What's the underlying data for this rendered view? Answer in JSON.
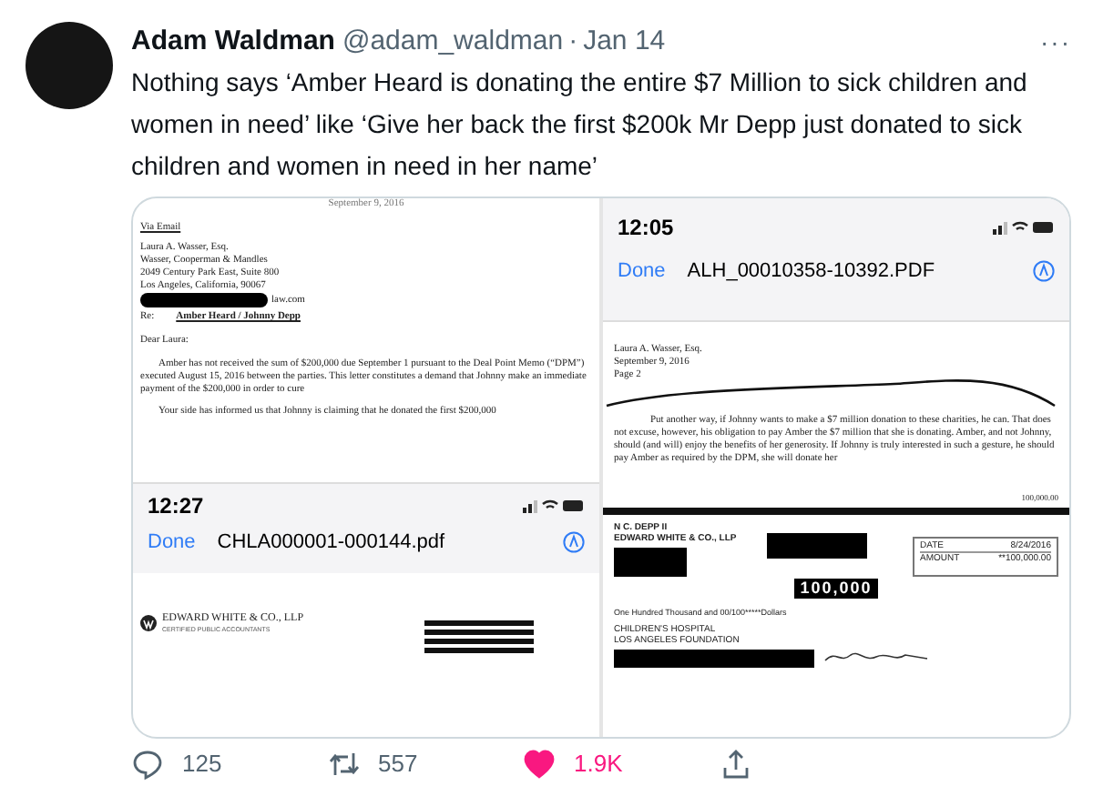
{
  "tweet": {
    "author": "Adam Waldman",
    "handle": "@adam_waldman",
    "separator": "·",
    "date": "Jan 14",
    "more": "···",
    "text": "Nothing says ‘Amber Heard is donating the entire $7 Million to sick children and women in need’ like ‘Give her back the first $200k Mr Depp just donated to sick children and women in need in her name’"
  },
  "media": {
    "left": {
      "letter": {
        "date_line": "September 9, 2016",
        "via": "Via Email",
        "address": [
          "Laura A. Wasser, Esq.",
          "Wasser, Cooperman & Mandles",
          "2049 Century Park East, Suite 800",
          "Los Angeles, California, 90067"
        ],
        "email_tail": "law.com",
        "re_label": "Re:",
        "re_text": "Amber Heard / Johnny Depp",
        "salutation": "Dear Laura:",
        "paragraph": "Amber has not received the sum of $200,000 due September 1 pursuant to the Deal Point Memo (“DPM”) executed August 15, 2016 between the parties. This letter constitutes a demand that Johnny make an immediate payment of the $200,000 in order to cure",
        "paragraph_2": "Your side has informed us that Johnny is claiming that he donated the first $200,000"
      },
      "phone": {
        "time": "12:27",
        "done": "Done",
        "file": "CHLA000001-000144.pdf"
      },
      "logo": {
        "name": "EDWARD WHITE & CO., LLP",
        "subtitle": "CERTIFIED PUBLIC ACCOUNTANTS"
      }
    },
    "right": {
      "phone": {
        "time": "12:05",
        "done": "Done",
        "file": "ALH_00010358-10392.PDF"
      },
      "letter": {
        "header": [
          "Laura A. Wasser, Esq.",
          "September 9, 2016",
          "Page 2"
        ],
        "paragraph": "Put another way, if Johnny wants to make a $7 million donation to these charities, he can. That does not excuse, however, his obligation to pay Amber the $7 million that she is donating. Amber, and not Johnny, should (and will) enjoy the benefits of her generosity. If Johnny is truly interested in such a gesture, he should pay Amber as required by the DPM, she will donate her"
      },
      "check": {
        "corner_amount": "100,000.00",
        "payer": "N C. DEPP II",
        "firm": "EDWARD WHITE & CO., LLP",
        "date_label": "DATE",
        "date": "8/24/2016",
        "amount_label": "AMOUNT",
        "amount": "**100,000.00",
        "stamp": "100,000",
        "words": "One Hundred Thousand and 00/100*****Dollars",
        "payee": [
          "CHILDREN'S HOSPITAL",
          "LOS ANGELES FOUNDATION"
        ]
      }
    }
  },
  "actions": [
    {
      "kind": "reply",
      "count": "125"
    },
    {
      "kind": "retweet",
      "count": "557"
    },
    {
      "kind": "like",
      "count": "1.9K",
      "liked": true
    },
    {
      "kind": "share"
    }
  ]
}
